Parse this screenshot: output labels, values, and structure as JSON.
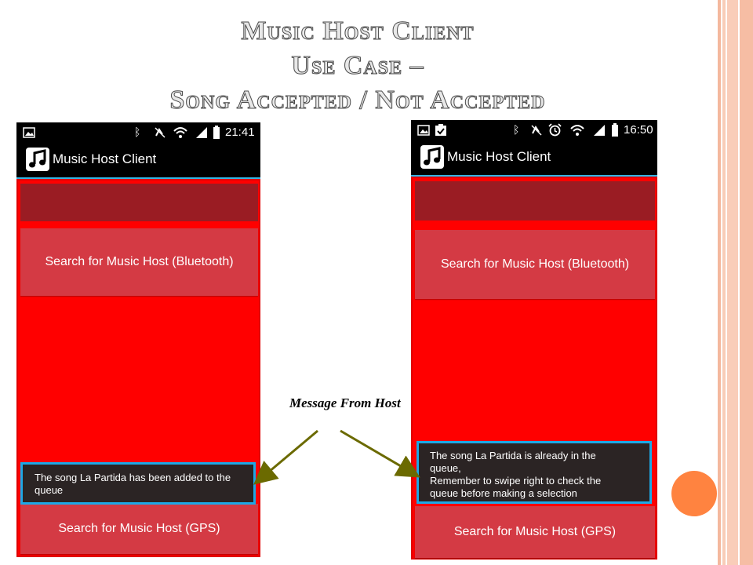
{
  "slide": {
    "title_lines": [
      "Music Host Client",
      "Use Case –",
      "Song Accepted / Not Accepted"
    ],
    "callout_label": "Message From Host",
    "accent_circle_color": "#ff8340"
  },
  "phones": [
    {
      "status_time": "21:41",
      "app_title": "Music Host Client",
      "button_bluetooth": "Search for Music Host (Bluetooth)",
      "button_gps": "Search for Music Host (GPS)",
      "toast_lines": [
        "The song La Partida has been added to the",
        "queue"
      ]
    },
    {
      "status_time": "16:50",
      "app_title": "Music Host Client",
      "button_bluetooth": "Search for Music Host (Bluetooth)",
      "button_gps": "Search for Music Host (GPS)",
      "toast_lines": [
        "The song La Partida is already in the",
        "queue,",
        "Remember to swipe right to check the",
        "queue before making a selection"
      ]
    }
  ],
  "colors": {
    "content_background": "#ff0000",
    "button_background": "#d43a44",
    "toast_border": "#1da8e6",
    "arrow": "#6b6a00"
  }
}
